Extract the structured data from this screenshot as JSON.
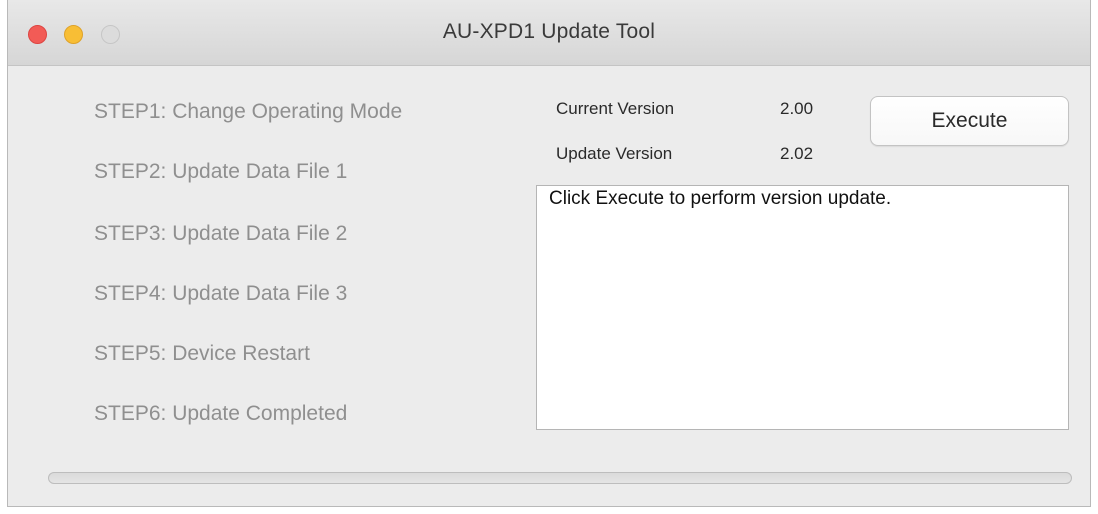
{
  "window": {
    "title": "AU-XPD1 Update Tool"
  },
  "steps": [
    {
      "label": "STEP1: Change Operating Mode"
    },
    {
      "label": "STEP2: Update Data File 1"
    },
    {
      "label": "STEP3: Update Data File 2"
    },
    {
      "label": "STEP4: Update Data File 3"
    },
    {
      "label": "STEP5: Device Restart"
    },
    {
      "label": "STEP6: Update Completed"
    }
  ],
  "version": {
    "current_label": "Current Version",
    "current_value": "2.00",
    "update_label": "Update Version",
    "update_value": "2.02"
  },
  "execute_button": {
    "label": "Execute"
  },
  "log": {
    "text": "Click Execute to perform version update."
  },
  "progress": {
    "value_percent": 0
  },
  "colors": {
    "close": "#f25b56",
    "minimize": "#f8be35",
    "zoom_disabled": "#dcdcdc",
    "step_text": "#8f8f8f"
  }
}
